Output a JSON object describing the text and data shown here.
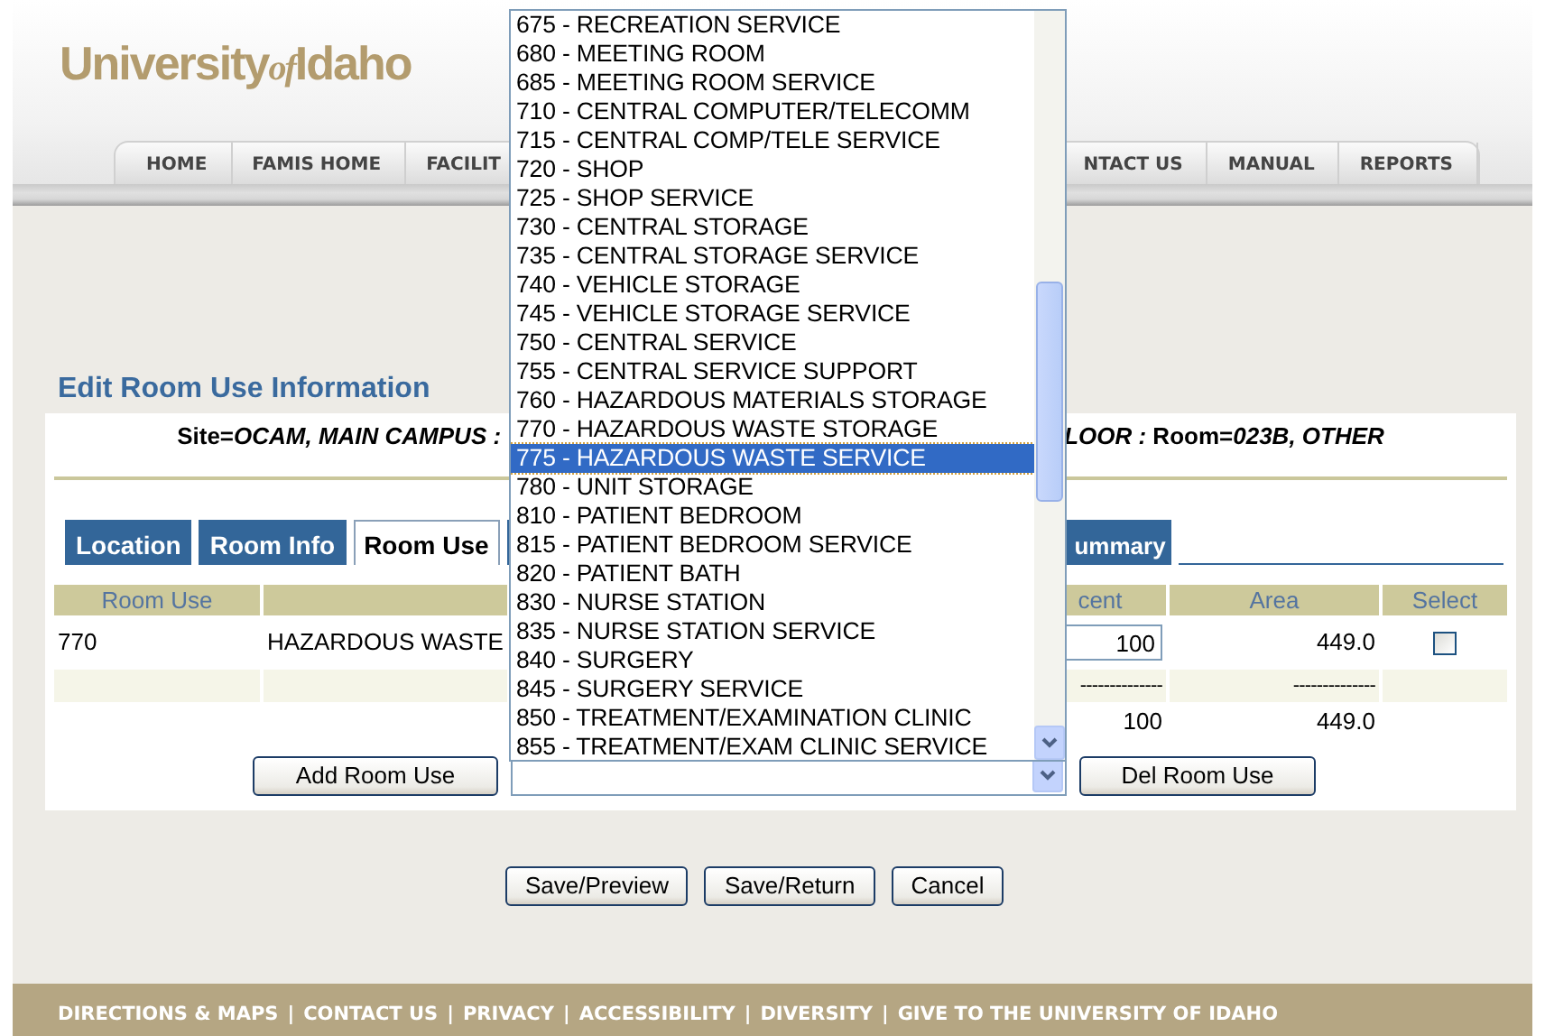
{
  "header": {
    "logo": {
      "first": "University",
      "middle": "of",
      "last": "Idaho"
    },
    "nav": {
      "left": [
        "HOME",
        "FAMIS HOME",
        "FACILIT"
      ],
      "right": [
        "NTACT US",
        "MANUAL",
        "REPORTS"
      ]
    }
  },
  "page_title": "Edit Room Use Information",
  "location_line": {
    "left": "Site=*OCAM, MAIN CAMPUS :*",
    "right": "*LOOR :* Room=*023B, OTHER*"
  },
  "tabs": [
    {
      "label": "Location",
      "selected": false
    },
    {
      "label": "Room Info",
      "selected": false
    },
    {
      "label": "Room Use",
      "selected": true
    },
    {
      "label": "ummary",
      "selected": false
    }
  ],
  "table": {
    "columns": {
      "room_use": "Room Use",
      "percent": "cent",
      "area": "Area",
      "select": "Select"
    },
    "rows": [
      {
        "kind": "entry",
        "room_use": "770",
        "description": "HAZARDOUS WASTE",
        "percent": "100",
        "area": "449.0",
        "checked": false
      },
      {
        "kind": "rule",
        "percent": "--------------",
        "area": "--------------"
      },
      {
        "kind": "total",
        "percent": "100",
        "area": "449.0"
      }
    ]
  },
  "add_button": "Add Room Use",
  "delete_button": "Del Room Use",
  "room_use_select": {
    "expanded": true,
    "options": [
      {
        "label": "675 - RECREATION SERVICE",
        "selected": false
      },
      {
        "label": "680 - MEETING ROOM",
        "selected": false
      },
      {
        "label": "685 - MEETING ROOM SERVICE",
        "selected": false
      },
      {
        "label": "710 - CENTRAL COMPUTER/TELECOMM",
        "selected": false
      },
      {
        "label": "715 - CENTRAL COMP/TELE SERVICE",
        "selected": false
      },
      {
        "label": "720 - SHOP",
        "selected": false
      },
      {
        "label": "725 - SHOP SERVICE",
        "selected": false
      },
      {
        "label": "730 - CENTRAL STORAGE",
        "selected": false
      },
      {
        "label": "735 - CENTRAL STORAGE SERVICE",
        "selected": false
      },
      {
        "label": "740 - VEHICLE STORAGE",
        "selected": false
      },
      {
        "label": "745 - VEHICLE STORAGE SERVICE",
        "selected": false
      },
      {
        "label": "750 - CENTRAL SERVICE",
        "selected": false
      },
      {
        "label": "755 - CENTRAL SERVICE SUPPORT",
        "selected": false
      },
      {
        "label": "760 - HAZARDOUS MATERIALS STORAGE",
        "selected": false
      },
      {
        "label": "770 - HAZARDOUS WASTE STORAGE",
        "selected": false
      },
      {
        "label": "775 - HAZARDOUS WASTE SERVICE",
        "selected": true
      },
      {
        "label": "780 - UNIT STORAGE",
        "selected": false
      },
      {
        "label": "810 - PATIENT BEDROOM",
        "selected": false
      },
      {
        "label": "815 - PATIENT BEDROOM SERVICE",
        "selected": false
      },
      {
        "label": "820 - PATIENT BATH",
        "selected": false
      },
      {
        "label": "830 - NURSE STATION",
        "selected": false
      },
      {
        "label": "835 - NURSE STATION SERVICE",
        "selected": false
      },
      {
        "label": "840 - SURGERY",
        "selected": false
      },
      {
        "label": "845 - SURGERY SERVICE",
        "selected": false
      },
      {
        "label": "850 - TREATMENT/EXAMINATION CLINIC",
        "selected": false
      },
      {
        "label": "855 - TREATMENT/EXAM CLINIC SERVICE",
        "selected": false
      }
    ]
  },
  "form_buttons": [
    "Save/Preview",
    "Save/Return",
    "Cancel"
  ],
  "footer": {
    "separator": "|",
    "links": [
      "DIRECTIONS & MAPS",
      "CONTACT US",
      "PRIVACY",
      "ACCESSIBILITY",
      "DIVERSITY",
      "GIVE TO THE UNIVERSITY OF IDAHO"
    ]
  }
}
